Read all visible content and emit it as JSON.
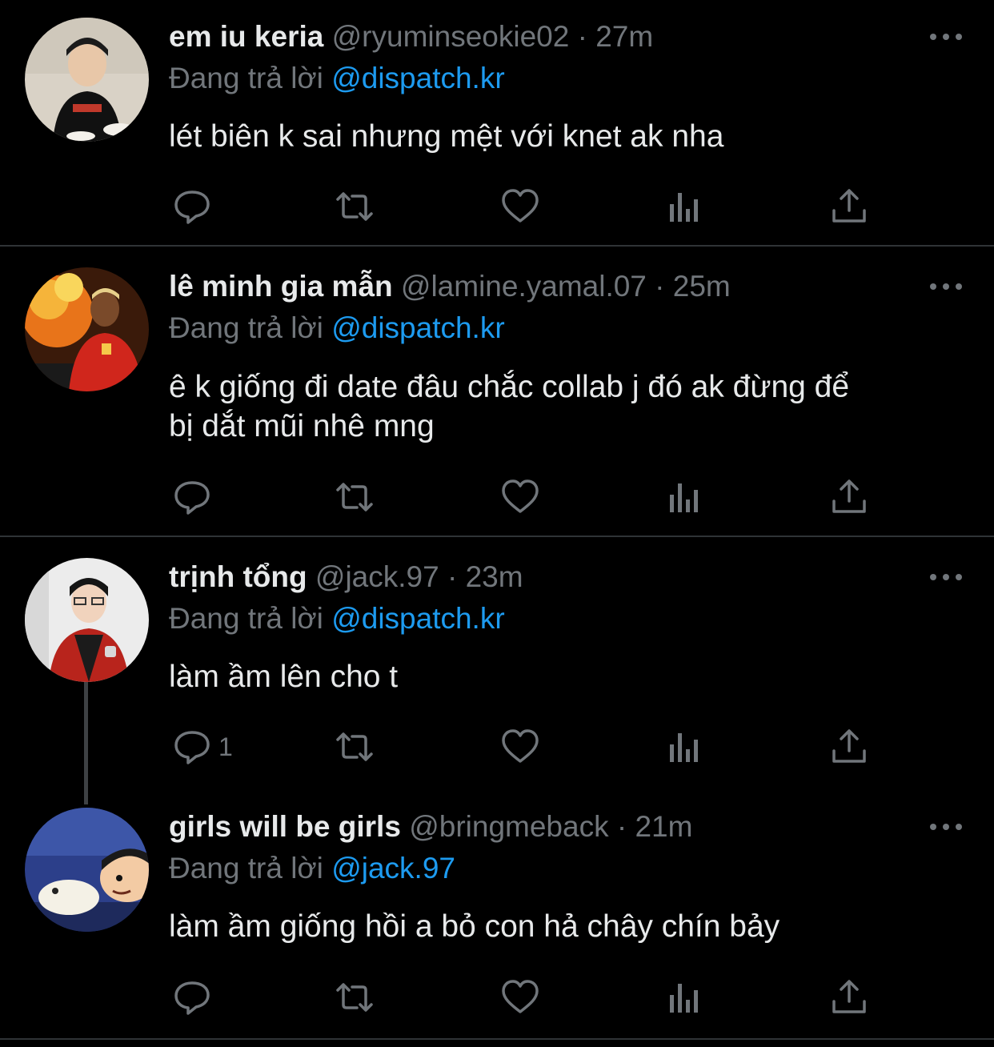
{
  "tweets": [
    {
      "name": "em iu keria",
      "handle": "@ryuminseokie02",
      "time": "27m",
      "separator": "·",
      "reply_prefix": "Đang trả lời",
      "reply_to": "@dispatch.kr",
      "text": "lét biên k sai nhưng mệt với knet ak nha",
      "reply_count": ""
    },
    {
      "name": "lê minh gia mẫn",
      "handle": "@lamine.yamal.07",
      "time": "25m",
      "separator": "·",
      "reply_prefix": "Đang trả lời",
      "reply_to": "@dispatch.kr",
      "text_line1": "ê k giống đi date đâu chắc collab j đó ak đừng để",
      "text_line2": "bị dắt mũi nhê mng",
      "reply_count": ""
    },
    {
      "name": "trịnh tổng",
      "handle": "@jack.97",
      "time": "23m",
      "separator": "·",
      "reply_prefix": "Đang trả lời",
      "reply_to": "@dispatch.kr",
      "text": "làm ầm lên cho t",
      "reply_count": "1"
    },
    {
      "name": "girls will be girls",
      "handle": "@bringmeback",
      "time": "21m",
      "separator": "·",
      "reply_prefix": "Đang trả lời",
      "reply_to": "@jack.97",
      "text": "làm ầm giống hồi a bỏ con hả chây chín bảy",
      "reply_count": ""
    }
  ],
  "icons": {
    "reply": "reply-icon",
    "retweet": "retweet-icon",
    "like": "heart-icon",
    "views": "views-icon",
    "share": "share-icon",
    "more": "more-icon"
  },
  "colors": {
    "background": "#000000",
    "text": "#e7e9ea",
    "muted": "#71767b",
    "link": "#1d9bf0",
    "divider": "#2f3336"
  }
}
